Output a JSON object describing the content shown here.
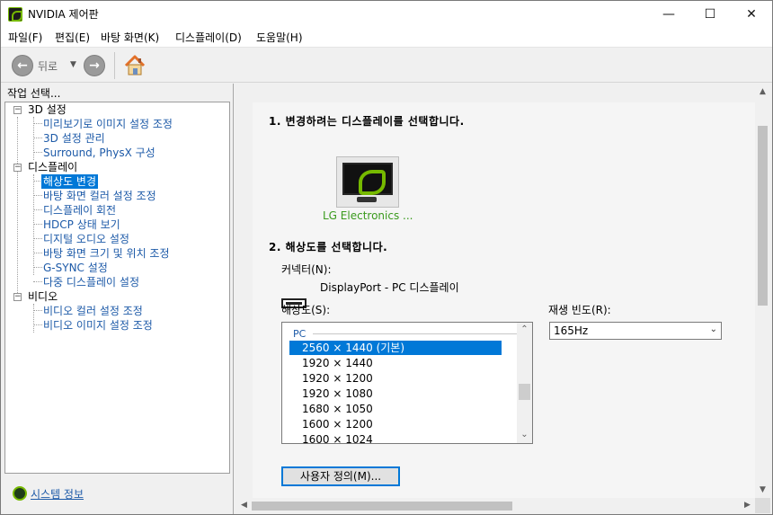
{
  "window": {
    "title": "NVIDIA 제어판",
    "minimize_glyph": "—",
    "maximize_glyph": "☐",
    "close_glyph": "✕"
  },
  "menu": [
    "파일(F)",
    "편집(E)",
    "바탕 화면(K)",
    "디스플레이(D)",
    "도움말(H)"
  ],
  "toolbar": {
    "back_label": "뒤로",
    "back_glyph": "←",
    "forward_glyph": "→",
    "dropdown_glyph": "▼"
  },
  "left_panel": {
    "header": "작업 선택...",
    "tree": [
      {
        "label": "3D 설정",
        "children": [
          "미리보기로 이미지 설정 조정",
          "3D 설정 관리",
          "Surround, PhysX 구성"
        ]
      },
      {
        "label": "디스플레이",
        "children": [
          "해상도 변경",
          "바탕 화면 컬러 설정 조정",
          "디스플레이 회전",
          "HDCP 상태 보기",
          "디지털 오디오 설정",
          "바탕 화면 크기 및 위치 조정",
          "G-SYNC 설정",
          "다중 디스플레이 설정"
        ]
      },
      {
        "label": "비디오",
        "children": [
          "비디오 컬러 설정 조정",
          "비디오 이미지 설정 조정"
        ]
      }
    ],
    "collapse_glyph": "−",
    "selected": "해상도 변경",
    "system_info": "시스템 정보"
  },
  "content": {
    "step1_title": "1. 변경하려는 디스플레이를 선택합니다.",
    "monitor_label": "LG Electronics ...",
    "step2_title": "2. 해상도를 선택합니다.",
    "connector_label": "커넥터(N):",
    "connector_value": "DisplayPort - PC 디스플레이",
    "resolution_label": "해상도(S):",
    "resolution_group": "PC",
    "resolutions": [
      "2560 × 1440 (기본)",
      "1920 × 1440",
      "1920 × 1200",
      "1920 × 1080",
      "1680 × 1050",
      "1600 × 1200",
      "1600 × 1024"
    ],
    "selected_resolution": "2560 × 1440 (기본)",
    "refresh_label": "재생 빈도(R):",
    "refresh_value": "165Hz",
    "custom_button": "사용자 정의(M)..."
  },
  "scroll": {
    "up": "▲",
    "down": "▼",
    "left": "◀",
    "right": "▶",
    "chev_up": "⌃",
    "chev_down": "⌄"
  },
  "colors": {
    "accent": "#0078d7",
    "link": "#1d5aa8",
    "nvidia_green": "#76b900",
    "monitor_label": "#3a9a1d"
  }
}
